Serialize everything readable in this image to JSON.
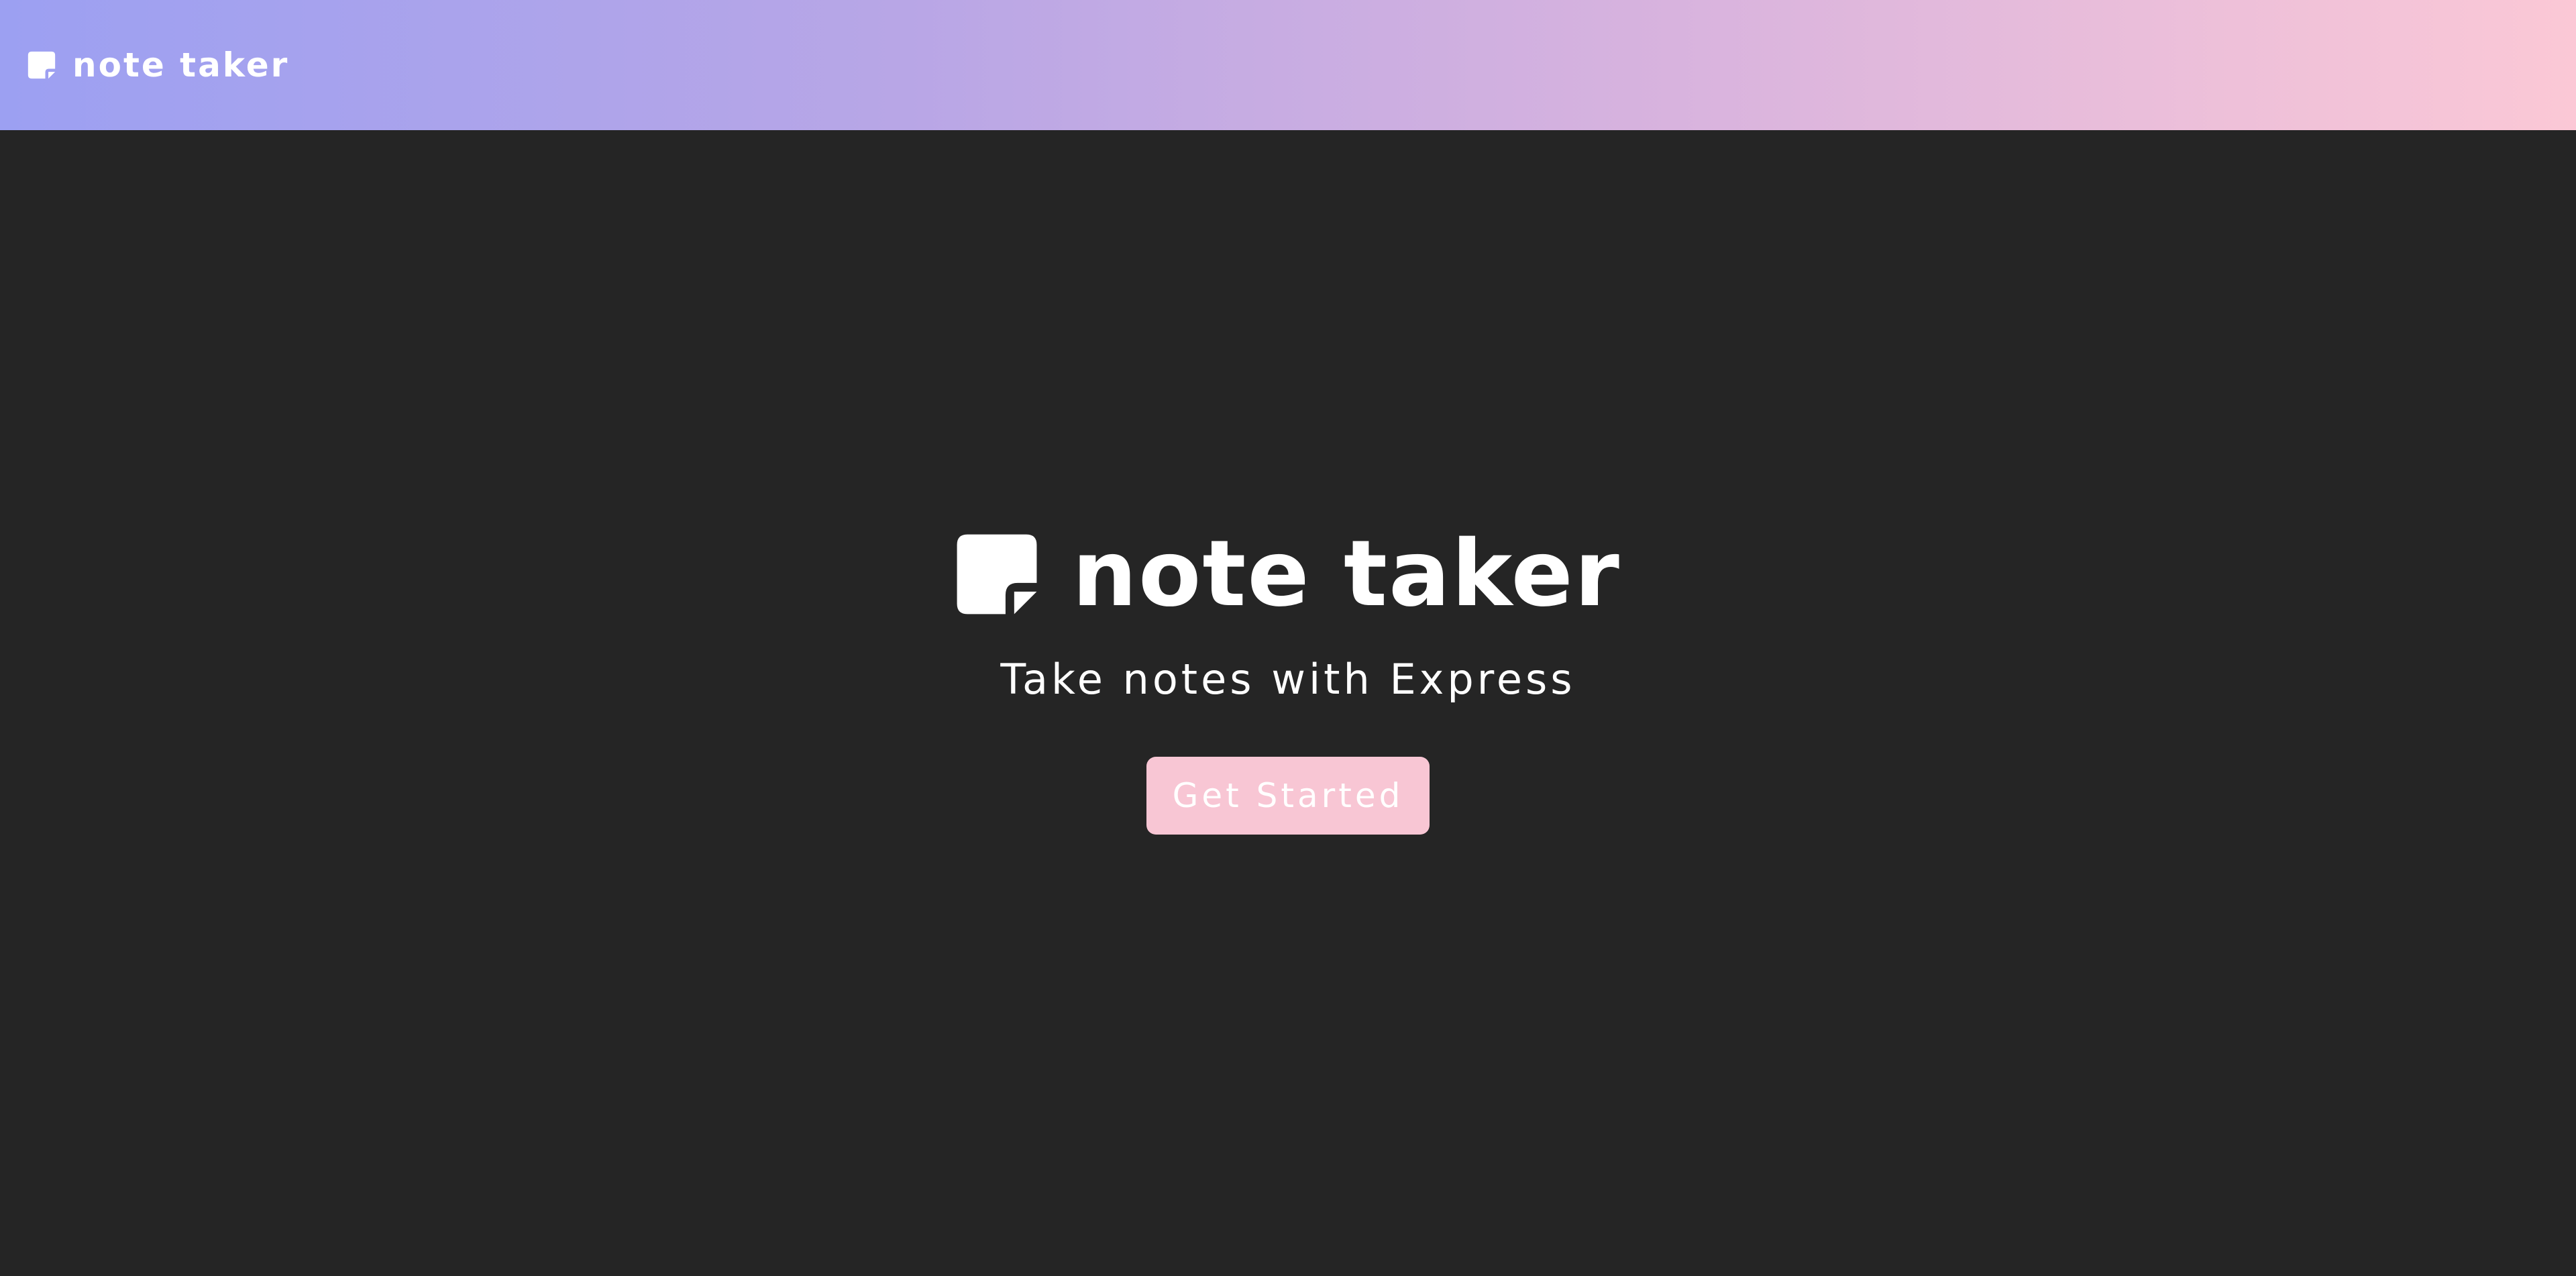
{
  "navbar": {
    "brand_label": "note taker",
    "brand_icon": "sticky-note-icon",
    "gradient": [
      "#9ca0f2",
      "#b8a6e6",
      "#d8b3de",
      "#fbc8d6"
    ]
  },
  "hero": {
    "title": "note taker",
    "title_icon": "sticky-note-icon",
    "subtitle": "Take notes with Express",
    "cta_label": "Get Started"
  },
  "colors": {
    "background": "#252525",
    "text": "#ffffff",
    "button": "#f8c6d4"
  }
}
